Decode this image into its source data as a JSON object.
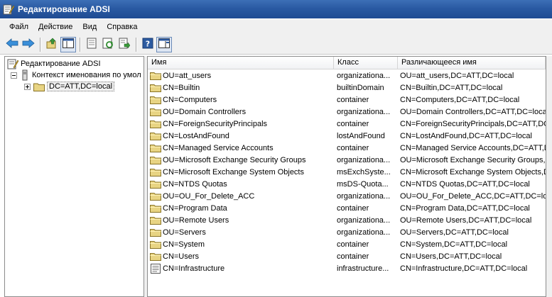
{
  "window": {
    "title": "Редактирование ADSI"
  },
  "menu": {
    "items": [
      "Файл",
      "Действие",
      "Вид",
      "Справка"
    ]
  },
  "toolbar": {
    "buttons": [
      "back-arrow-icon",
      "forward-arrow-icon",
      "up-folder-icon",
      "show-hide-tree-icon",
      "properties-icon",
      "refresh-icon",
      "export-list-icon",
      "help-icon",
      "show-action-pane-icon"
    ]
  },
  "tree": {
    "root": "Редактирование ADSI",
    "context": "Контекст именования по умол",
    "node": "DC=ATT,DC=local"
  },
  "list": {
    "columns": [
      "Имя",
      "Класс",
      "Различающееся имя"
    ],
    "rows": [
      {
        "name": "OU=att_users",
        "class": "organizationa...",
        "dn": "OU=att_users,DC=ATT,DC=local",
        "icon": "folder"
      },
      {
        "name": "CN=Builtin",
        "class": "builtinDomain",
        "dn": "CN=Builtin,DC=ATT,DC=local",
        "icon": "folder"
      },
      {
        "name": "CN=Computers",
        "class": "container",
        "dn": "CN=Computers,DC=ATT,DC=local",
        "icon": "folder"
      },
      {
        "name": "OU=Domain Controllers",
        "class": "organizationa...",
        "dn": "OU=Domain Controllers,DC=ATT,DC=local",
        "icon": "folder"
      },
      {
        "name": "CN=ForeignSecurityPrincipals",
        "class": "container",
        "dn": "CN=ForeignSecurityPrincipals,DC=ATT,DC",
        "icon": "folder"
      },
      {
        "name": "CN=LostAndFound",
        "class": "lostAndFound",
        "dn": "CN=LostAndFound,DC=ATT,DC=local",
        "icon": "folder"
      },
      {
        "name": "CN=Managed Service Accounts",
        "class": "container",
        "dn": "CN=Managed Service Accounts,DC=ATT,DC=l",
        "icon": "folder"
      },
      {
        "name": "OU=Microsoft Exchange Security Groups",
        "class": "organizationa...",
        "dn": "OU=Microsoft Exchange Security Groups,DC",
        "icon": "folder"
      },
      {
        "name": "CN=Microsoft Exchange System Objects",
        "class": "msExchSyste...",
        "dn": "CN=Microsoft Exchange System Objects,D",
        "icon": "folder"
      },
      {
        "name": "CN=NTDS Quotas",
        "class": "msDS-Quota...",
        "dn": "CN=NTDS Quotas,DC=ATT,DC=local",
        "icon": "folder"
      },
      {
        "name": "OU=OU_For_Delete_ACC",
        "class": "organizationa...",
        "dn": "OU=OU_For_Delete_ACC,DC=ATT,DC=local",
        "icon": "folder"
      },
      {
        "name": "CN=Program Data",
        "class": "container",
        "dn": "CN=Program Data,DC=ATT,DC=local",
        "icon": "folder"
      },
      {
        "name": "OU=Remote Users",
        "class": "organizationa...",
        "dn": "OU=Remote Users,DC=ATT,DC=local",
        "icon": "folder"
      },
      {
        "name": "OU=Servers",
        "class": "organizationa...",
        "dn": "OU=Servers,DC=ATT,DC=local",
        "icon": "folder"
      },
      {
        "name": "CN=System",
        "class": "container",
        "dn": "CN=System,DC=ATT,DC=local",
        "icon": "folder"
      },
      {
        "name": "CN=Users",
        "class": "container",
        "dn": "CN=Users,DC=ATT,DC=local",
        "icon": "folder"
      },
      {
        "name": "CN=Infrastructure",
        "class": "infrastructure...",
        "dn": "CN=Infrastructure,DC=ATT,DC=local",
        "icon": "document"
      }
    ]
  },
  "colors": {
    "titlebar": "#2a5aa3",
    "chrome": "#f0f0f0",
    "folder": "#e8d483"
  }
}
